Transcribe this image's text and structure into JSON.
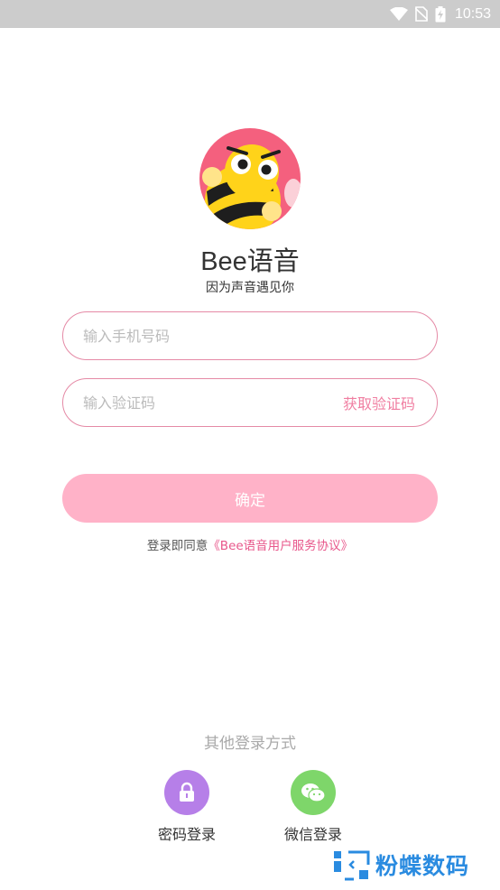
{
  "status_bar": {
    "time": "10:53",
    "icons": [
      "wifi-icon",
      "no-sim-icon",
      "battery-charging-icon"
    ]
  },
  "app": {
    "name": "Bee语音",
    "tagline": "因为声音遇见你"
  },
  "form": {
    "phone_placeholder": "输入手机号码",
    "code_placeholder": "输入验证码",
    "get_code_label": "获取验证码",
    "confirm_label": "确定"
  },
  "agreement": {
    "prefix": "登录即同意",
    "link": "《Bee语音用户服务协议》"
  },
  "other_login": {
    "title": "其他登录方式",
    "options": [
      {
        "label": "密码登录",
        "icon": "lock-icon",
        "color": "#b67fe8"
      },
      {
        "label": "微信登录",
        "icon": "wechat-icon",
        "color": "#7ed66a"
      }
    ]
  },
  "watermark": {
    "text": "粉蝶数码"
  },
  "colors": {
    "accent": "#f07ea1",
    "button": "#ffb2c8",
    "border": "#e58aa6",
    "link": "#e8578b"
  }
}
